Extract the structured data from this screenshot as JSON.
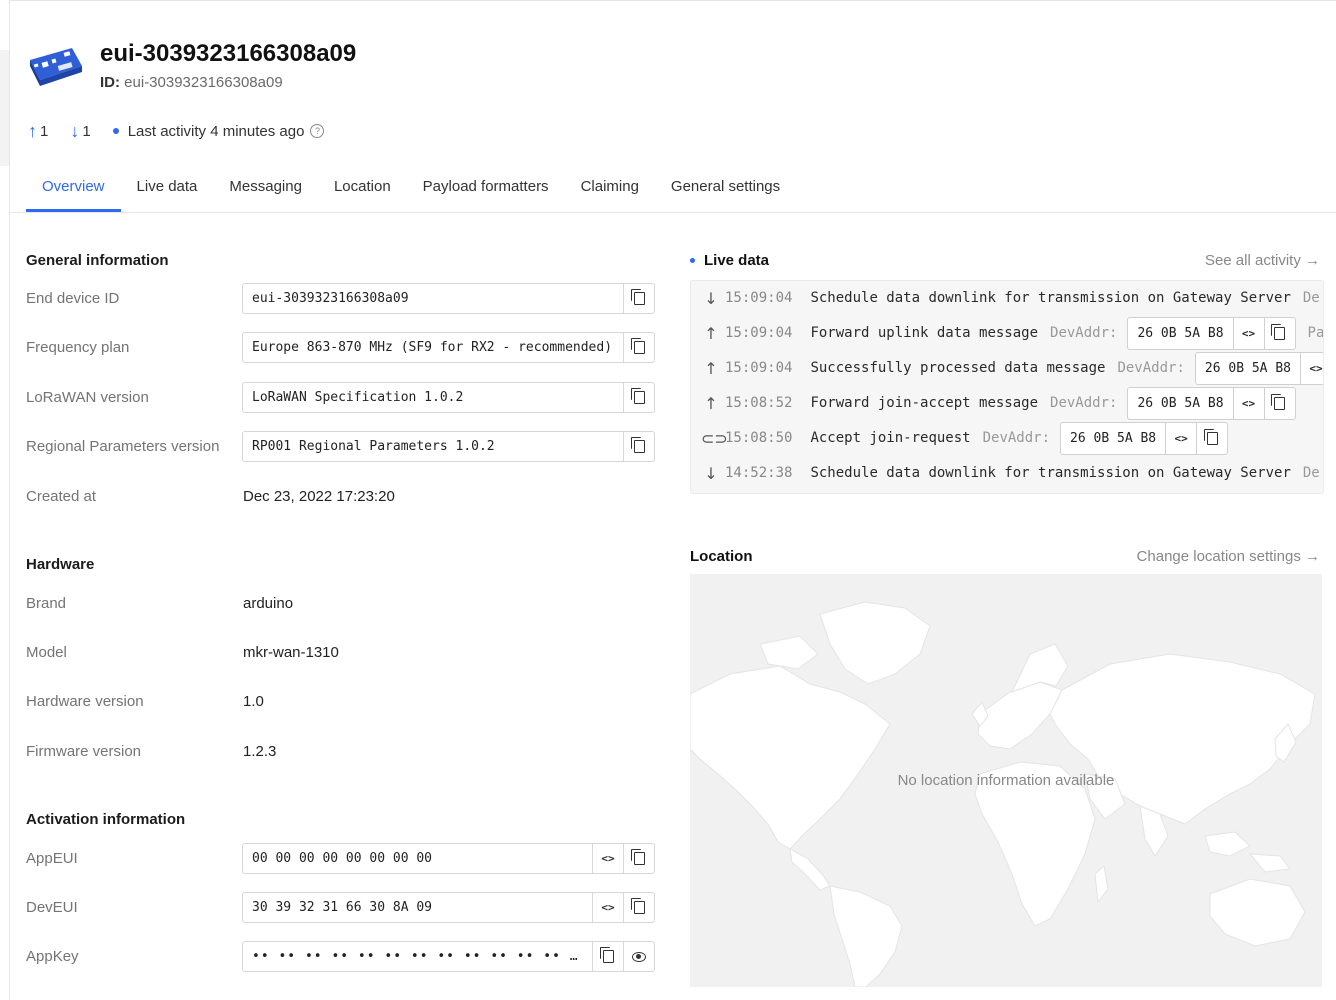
{
  "header": {
    "title": "eui-3039323166308a09",
    "id_label": "ID:",
    "id_value": "eui-3039323166308a09",
    "uplink_count": "1",
    "downlink_count": "1",
    "last_activity": "Last activity 4 minutes ago"
  },
  "tabs": [
    "Overview",
    "Live data",
    "Messaging",
    "Location",
    "Payload formatters",
    "Claiming",
    "General settings"
  ],
  "general": {
    "title": "General information",
    "end_device_id_label": "End device ID",
    "end_device_id": "eui-3039323166308a09",
    "frequency_plan_label": "Frequency plan",
    "frequency_plan": "Europe 863-870 MHz (SF9 for RX2 - recommended)",
    "lorawan_version_label": "LoRaWAN version",
    "lorawan_version": "LoRaWAN Specification 1.0.2",
    "regional_params_label": "Regional Parameters version",
    "regional_params": "RP001 Regional Parameters 1.0.2",
    "created_at_label": "Created at",
    "created_at": "Dec 23, 2022 17:23:20"
  },
  "hardware": {
    "title": "Hardware",
    "brand_label": "Brand",
    "brand": "arduino",
    "model_label": "Model",
    "model": "mkr-wan-1310",
    "hw_version_label": "Hardware version",
    "hw_version": "1.0",
    "fw_version_label": "Firmware version",
    "fw_version": "1.2.3"
  },
  "activation": {
    "title": "Activation information",
    "appeui_label": "AppEUI",
    "appeui": "00 00 00 00 00 00 00 00",
    "deveui_label": "DevEUI",
    "deveui": "30 39 32 31 66 30 8A 09",
    "appkey_label": "AppKey",
    "appkey": "•• •• •• •• •• •• •• •• •• •• •• •• •• •• •• ••"
  },
  "live_data": {
    "title": "Live data",
    "see_all": "See all activity →",
    "events": [
      {
        "icon": "arrow-down-icon",
        "time": "15:09:04",
        "text": "Schedule data downlink for transmission on Gateway Server",
        "attr": "",
        "addr": "",
        "trail": "De"
      },
      {
        "icon": "arrow-up-icon",
        "time": "15:09:04",
        "text": "Forward uplink data message",
        "attr": "DevAddr:",
        "addr": "26 0B 5A B8",
        "trail": "Pa"
      },
      {
        "icon": "arrow-up-icon",
        "time": "15:09:04",
        "text": "Successfully processed data message",
        "attr": "DevAddr:",
        "addr": "26 0B 5A B8",
        "trail": ""
      },
      {
        "icon": "arrow-up-icon",
        "time": "15:08:52",
        "text": "Forward join-accept message",
        "attr": "DevAddr:",
        "addr": "26 0B 5A B8",
        "trail": ""
      },
      {
        "icon": "link-icon",
        "time": "15:08:50",
        "text": "Accept join-request",
        "attr": "DevAddr:",
        "addr": "26 0B 5A B8",
        "trail": ""
      },
      {
        "icon": "arrow-down-icon",
        "time": "14:52:38",
        "text": "Schedule data downlink for transmission on Gateway Server",
        "attr": "",
        "addr": "",
        "trail": "De"
      }
    ]
  },
  "location": {
    "title": "Location",
    "change_settings": "Change location settings →",
    "empty_message": "No location information available"
  },
  "colors": {
    "accent": "#2f69f0",
    "map_background": "#f1f1f1",
    "map_land": "#ffffff"
  }
}
